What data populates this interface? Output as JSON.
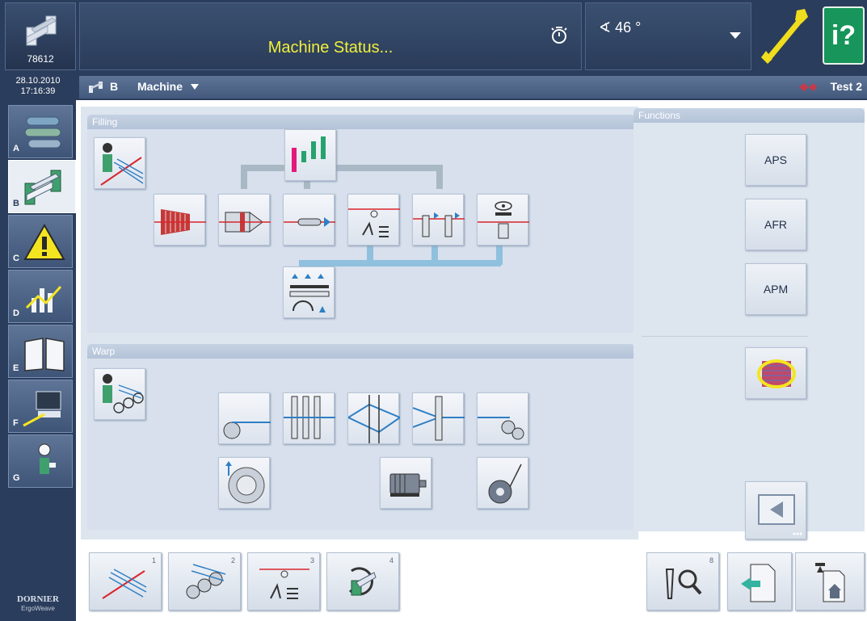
{
  "header": {
    "machine_number": "78612",
    "status_text": "Machine Status...",
    "angle": "46 °",
    "help_label": "i?"
  },
  "subbar": {
    "date": "28.10.2010",
    "time": "17:16:39",
    "machine_letter": "B",
    "machine_menu": "Machine",
    "style_name": "Test 2"
  },
  "sidebar": {
    "tabs": [
      {
        "letter": "A",
        "icon": "weaving-rollers-icon"
      },
      {
        "letter": "B",
        "icon": "machine-icon"
      },
      {
        "letter": "C",
        "icon": "warning-icon"
      },
      {
        "letter": "D",
        "icon": "chart-icon"
      },
      {
        "letter": "E",
        "icon": "book-icon"
      },
      {
        "letter": "F",
        "icon": "computer-icon"
      },
      {
        "letter": "G",
        "icon": "operator-icon"
      }
    ],
    "brand": "DORNIER",
    "brand_sub": "ErgoWeave"
  },
  "sections": {
    "filling": "Filling",
    "warp": "Warp",
    "functions": "Functions"
  },
  "functions": {
    "aps": "APS",
    "afr": "AFR",
    "apm": "APM"
  },
  "bottom_toolbar": [
    {
      "index": "1",
      "icon": "filling-threads-icon"
    },
    {
      "index": "2",
      "icon": "warp-beams-icon"
    },
    {
      "index": "3",
      "icon": "cutter-icon"
    },
    {
      "index": "4",
      "icon": "rotation-icon"
    },
    {
      "index": "8",
      "icon": "search-tools-icon"
    }
  ],
  "colors": {
    "background_dark": "#2b3d5c",
    "status_yellow": "#f2ef3a",
    "help_green": "#17955a",
    "panel": "#dde5ef",
    "thread_red": "#d9252b",
    "thread_blue": "#2f7fc4"
  }
}
